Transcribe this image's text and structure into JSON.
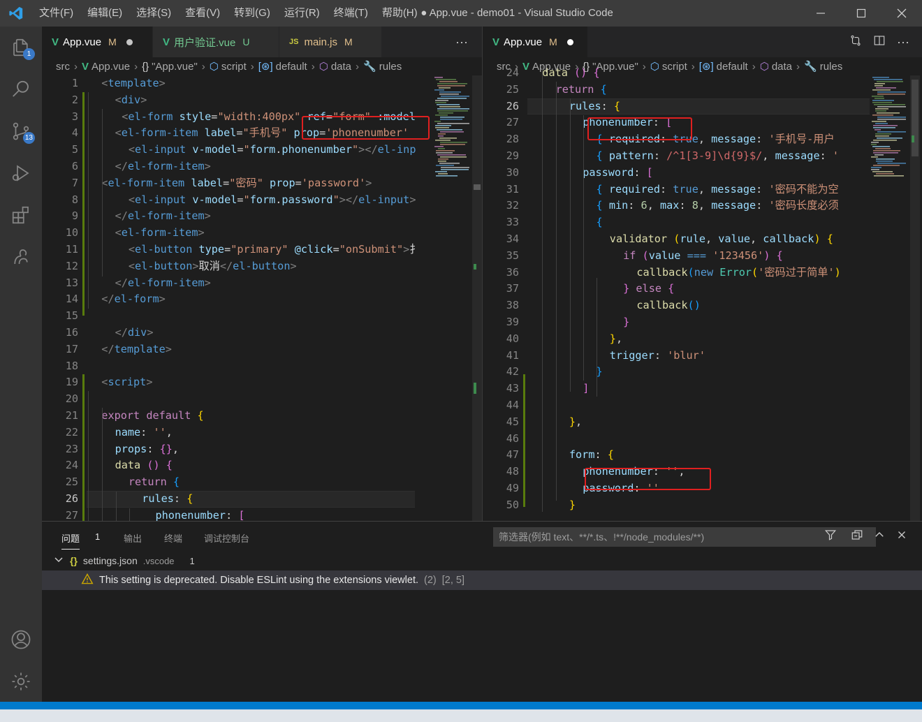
{
  "window": {
    "title": "● App.vue - demo01 - Visual Studio Code",
    "menu": [
      "文件(F)",
      "编辑(E)",
      "选择(S)",
      "查看(V)",
      "转到(G)",
      "运行(R)",
      "终端(T)",
      "帮助(H)"
    ]
  },
  "activity": {
    "explorer_badge": "1",
    "scm_badge": "13"
  },
  "left_group": {
    "tabs": [
      {
        "label": "App.vue",
        "status": "M"
      },
      {
        "label": "用户验证.vue",
        "status": "U"
      },
      {
        "label": "main.js",
        "status": "M"
      }
    ],
    "more": "···",
    "breadcrumb": [
      "src",
      "App.vue",
      "\"App.vue\"",
      "script",
      "default",
      "data",
      "rules"
    ],
    "line_numbers": [
      "1",
      "2",
      "3",
      "4",
      "5",
      "6",
      "7",
      "8",
      "9",
      "10",
      "11",
      "12",
      "13",
      "14",
      "15",
      "16",
      "17",
      "18",
      "19",
      "20",
      "21",
      "22",
      "23",
      "24",
      "25",
      "26",
      "27"
    ],
    "current_line": "26"
  },
  "right_group": {
    "tabs": [
      {
        "label": "App.vue",
        "status": "M"
      }
    ],
    "breadcrumb": [
      "src",
      "App.vue",
      "\"App.vue\"",
      "script",
      "default",
      "data",
      "rules"
    ],
    "line_numbers": [
      "24",
      "25",
      "26",
      "27",
      "28",
      "29",
      "30",
      "31",
      "32",
      "33",
      "34",
      "35",
      "36",
      "37",
      "38",
      "39",
      "40",
      "41",
      "42",
      "43",
      "44",
      "45",
      "46",
      "47",
      "48",
      "49",
      "50"
    ],
    "current_line": "26"
  },
  "panel": {
    "tabs": [
      "问题",
      "输出",
      "终端",
      "调试控制台"
    ],
    "problems_count": "1",
    "filter_placeholder": "筛选器(例如 text、**/*.ts、!**/node_modules/**)",
    "file": {
      "name": "settings.json",
      "folder": ".vscode",
      "count": "1"
    },
    "warning": {
      "message": "This setting is deprecated. Disable ESLint using the extensions viewlet.",
      "count": "(2)",
      "location": "[2, 5]"
    }
  }
}
